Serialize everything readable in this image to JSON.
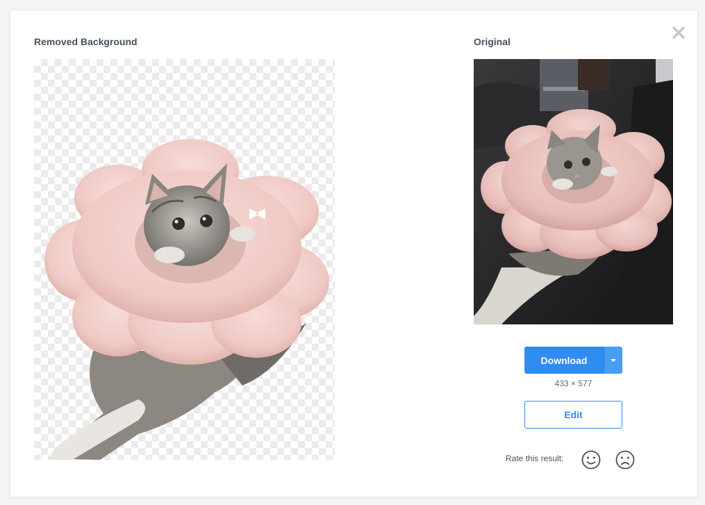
{
  "modal": {
    "close_icon": "close-icon",
    "removed": {
      "title": "Removed Background"
    },
    "original": {
      "title": "Original"
    },
    "actions": {
      "download_label": "Download",
      "dropdown_icon": "chevron-down-icon",
      "dimensions": "433 × 577",
      "edit_label": "Edit"
    },
    "rating": {
      "label": "Rate this result:",
      "positive_icon": "smile-icon",
      "negative_icon": "frown-icon"
    }
  },
  "colors": {
    "accent": "#2f8cf0",
    "title": "#45505c",
    "checker": "#ebebeb"
  }
}
